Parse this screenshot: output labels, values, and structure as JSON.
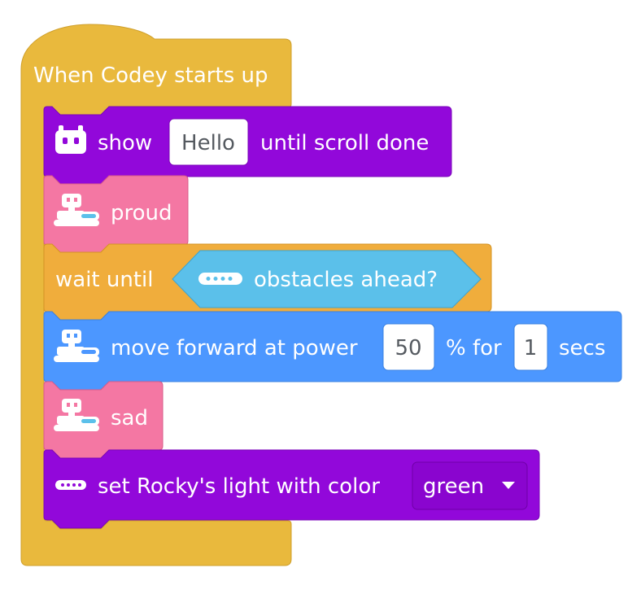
{
  "script": {
    "hat": {
      "label": "When Codey starts up",
      "color": "#e9b93d"
    },
    "blocks": [
      {
        "id": "show",
        "color": "#9208da",
        "icon": "codey-face-icon",
        "text_before": "show",
        "input_value": "Hello",
        "text_after": "until scroll done"
      },
      {
        "id": "proud",
        "color": "#f477a3",
        "icon": "rocky-robot-icon",
        "label": "proud"
      },
      {
        "id": "wait",
        "color": "#f0ad3c",
        "label": "wait until",
        "condition": {
          "color": "#5bc0ea",
          "icon": "rocky-sensor-icon",
          "label": "obstacles ahead?"
        }
      },
      {
        "id": "move",
        "color": "#4c97ff",
        "icon": "rocky-robot-icon",
        "text_before": "move forward at power",
        "power_value": "50",
        "text_middle": "% for",
        "seconds_value": "1",
        "text_after": "secs"
      },
      {
        "id": "sad",
        "color": "#f477a3",
        "icon": "rocky-robot-icon",
        "label": "sad"
      },
      {
        "id": "light",
        "color": "#9208da",
        "icon": "rocky-sensor-icon",
        "text_before": "set Rocky's light with color",
        "dropdown_value": "green",
        "dropdown_icon": "caret-down-icon"
      }
    ]
  }
}
